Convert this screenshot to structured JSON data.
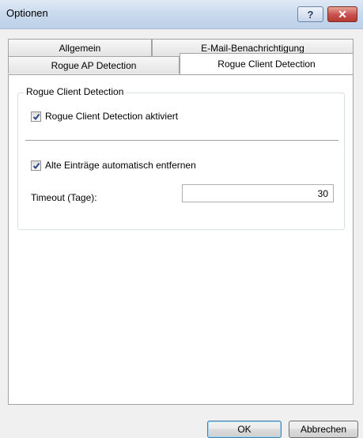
{
  "window": {
    "title": "Optionen",
    "help_glyph": "?",
    "close_glyph": "✕"
  },
  "tabs": {
    "row_back": [
      "Allgemein",
      "E-Mail-Benachrichtigung"
    ],
    "row_front": [
      "Rogue AP Detection",
      "Rogue Client Detection"
    ],
    "active": "Rogue Client Detection"
  },
  "group": {
    "label": "Rogue Client Detection",
    "enable_checkbox": {
      "label": "Rogue Client Detection aktiviert",
      "checked": true
    },
    "auto_remove_checkbox": {
      "label": "Alte Einträge automatisch entfernen",
      "checked": true
    },
    "timeout_label": "Timeout (Tage):",
    "timeout_value": "30"
  },
  "buttons": {
    "ok": "OK",
    "cancel": "Abbrechen"
  }
}
